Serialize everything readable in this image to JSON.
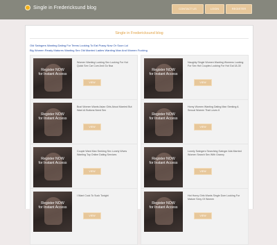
{
  "header": {
    "brand": "Single in Fredericksund blog",
    "nav": [
      "Contact us",
      "Login",
      "Register"
    ]
  },
  "page": {
    "title": "Single in Fredericksund blog",
    "top_links": [
      "Old Swingers Wanting Dating For Teens Looking To Eat Pussy Now Or Soon Lol",
      "Big Women Ready Matures Wanting Sex Old Married Ladies Wanting Man And Women Fucking"
    ]
  },
  "listings": [
    {
      "caption": "Register NOW\nfor Instant Access",
      "text": "Women Wanting Looking Sex Looking For Hot Quick Sex Car Cum And Go Nsa",
      "button": "View"
    },
    {
      "caption": "Register NOW\nfor Instant Access",
      "text": "Naughty Single Women Wanting Womens Looking For Sex Hot Couples Looking For Hot Gal 18-30",
      "button": "View"
    },
    {
      "caption": "Register NOW\nfor Instant Access",
      "text": "Bust Women Wants Asian Girls About Married But Want Ai Buttons Need Sex",
      "button": "View"
    },
    {
      "caption": "Register NOW\nfor Instant Access",
      "text": "Horny Women Wanting Dating Man Seeking A Sexual Women That Loves It",
      "button": "View"
    },
    {
      "caption": "Register NOW\nfor Instant Access",
      "text": "Couple Want Man Seeking Sex Lonely Wives Wanting Top Online Dating Services",
      "button": "View"
    },
    {
      "caption": "Register NOW\nfor Instant Access",
      "text": "Lonely Swingers Searching Swinger Ads Married Women Search Sex With Granny",
      "button": "View"
    },
    {
      "caption": "Register NOW\nfor Instant Access",
      "text": "I Want Cock To Suck Tonight",
      "button": "View"
    },
    {
      "caption": "Register NOW\nfor Instant Access",
      "text": "Hot Horny Girls Wants Single Dom Looking For Mature Sexy Gf Women",
      "button": "View"
    }
  ]
}
